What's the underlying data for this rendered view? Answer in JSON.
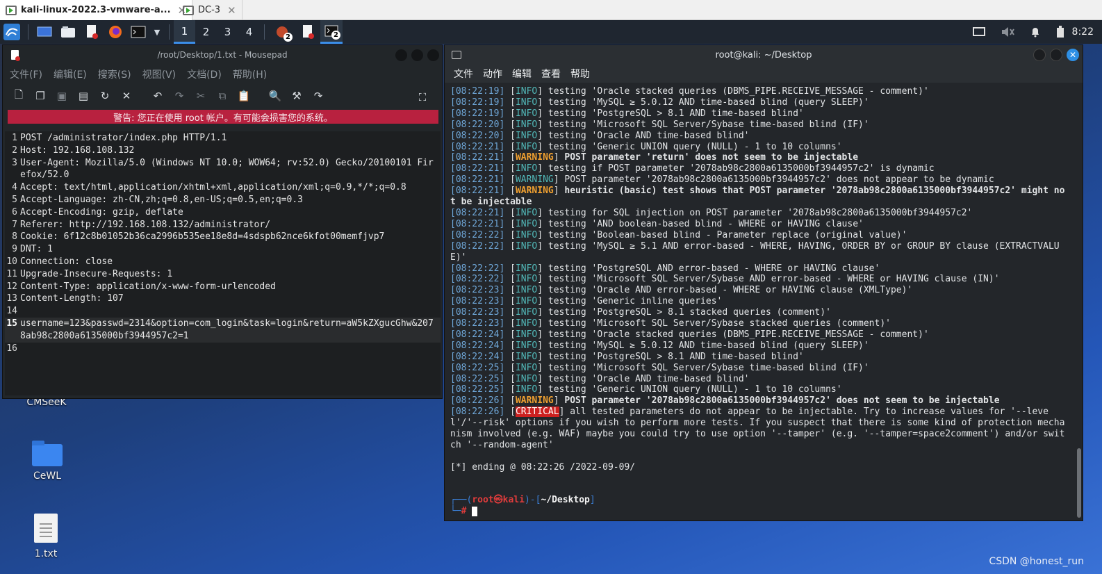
{
  "vm_tabs": {
    "active_label": "kali-linux-2022.3-vmware-a...",
    "inactive_label": "DC-3"
  },
  "panel": {
    "workspaces": [
      "1",
      "2",
      "3",
      "4"
    ],
    "badge_count_1": "2",
    "badge_count_2": "2",
    "clock": "8:22"
  },
  "desktop": {
    "icons": [
      "CMSeeK",
      "CeWL",
      "1.txt"
    ],
    "watermark": "CSDN @honest_run"
  },
  "mousepad": {
    "title": "/root/Desktop/1.txt - Mousepad",
    "menu": [
      "文件(F)",
      "编辑(E)",
      "搜索(S)",
      "视图(V)",
      "文档(D)",
      "帮助(H)"
    ],
    "warning": "警告: 您正在使用 root 帐户。有可能会损害您的系统。",
    "lines": [
      {
        "n": "1",
        "t": "POST /administrator/index.php HTTP/1.1"
      },
      {
        "n": "2",
        "t": "Host: 192.168.108.132"
      },
      {
        "n": "3",
        "t": "User-Agent: Mozilla/5.0 (Windows NT 10.0; WOW64; rv:52.0) Gecko/20100101 Firefox/52.0"
      },
      {
        "n": "4",
        "t": "Accept: text/html,application/xhtml+xml,application/xml;q=0.9,*/*;q=0.8"
      },
      {
        "n": "5",
        "t": "Accept-Language: zh-CN,zh;q=0.8,en-US;q=0.5,en;q=0.3"
      },
      {
        "n": "6",
        "t": "Accept-Encoding: gzip, deflate"
      },
      {
        "n": "7",
        "t": "Referer: http://192.168.108.132/administrator/"
      },
      {
        "n": "8",
        "t": "Cookie: 6f12c8b01052b36ca2996b535ee18e8d=4sdspb62nce6kfot00memfjvp7"
      },
      {
        "n": "9",
        "t": "DNT: 1"
      },
      {
        "n": "10",
        "t": "Connection: close"
      },
      {
        "n": "11",
        "t": "Upgrade-Insecure-Requests: 1"
      },
      {
        "n": "12",
        "t": "Content-Type: application/x-www-form-urlencoded"
      },
      {
        "n": "13",
        "t": "Content-Length: 107"
      },
      {
        "n": "14",
        "t": ""
      },
      {
        "n": "15",
        "t": "username=123&passwd=2314&option=com_login&task=login&return=aW5kZXgucGhw&2078ab98c2800a6135000bf3944957c2=1"
      },
      {
        "n": "16",
        "t": ""
      }
    ]
  },
  "terminal": {
    "title": "root@kali: ~/Desktop",
    "menu": [
      "文件",
      "动作",
      "编辑",
      "查看",
      "帮助"
    ],
    "logs": [
      {
        "ts": "[08:22:19]",
        "lv": "INFO",
        "msg": " testing 'Oracle stacked queries (DBMS_PIPE.RECEIVE_MESSAGE - comment)'"
      },
      {
        "ts": "[08:22:19]",
        "lv": "INFO",
        "msg": " testing 'MySQL ≥ 5.0.12 AND time-based blind (query SLEEP)'"
      },
      {
        "ts": "[08:22:19]",
        "lv": "INFO",
        "msg": " testing 'PostgreSQL > 8.1 AND time-based blind'"
      },
      {
        "ts": "[08:22:20]",
        "lv": "INFO",
        "msg": " testing 'Microsoft SQL Server/Sybase time-based blind (IF)'"
      },
      {
        "ts": "[08:22:20]",
        "lv": "INFO",
        "msg": " testing 'Oracle AND time-based blind'"
      },
      {
        "ts": "[08:22:21]",
        "lv": "INFO",
        "msg": " testing 'Generic UNION query (NULL) - 1 to 10 columns'"
      },
      {
        "ts": "[08:22:21]",
        "lv": "WARNING",
        "msg": " POST parameter 'return' does not seem to be injectable",
        "bold": true
      },
      {
        "ts": "[08:22:21]",
        "lv": "INFO",
        "msg": " testing if POST parameter '2078ab98c2800a6135000bf3944957c2' is dynamic"
      },
      {
        "ts": "[08:22:21]",
        "lv": "WARNING",
        "msg": " POST parameter '2078ab98c2800a6135000bf3944957c2' does not appear to be dynamic",
        "plainlv": true
      },
      {
        "ts": "[08:22:21]",
        "lv": "WARNING",
        "msg": " heuristic (basic) test shows that POST parameter '2078ab98c2800a6135000bf3944957c2' might not be injectable",
        "bold": true
      },
      {
        "ts": "[08:22:21]",
        "lv": "INFO",
        "msg": " testing for SQL injection on POST parameter '2078ab98c2800a6135000bf3944957c2'"
      },
      {
        "ts": "[08:22:21]",
        "lv": "INFO",
        "msg": " testing 'AND boolean-based blind - WHERE or HAVING clause'"
      },
      {
        "ts": "[08:22:22]",
        "lv": "INFO",
        "msg": " testing 'Boolean-based blind - Parameter replace (original value)'"
      },
      {
        "ts": "[08:22:22]",
        "lv": "INFO",
        "msg": " testing 'MySQL ≥ 5.1 AND error-based - WHERE, HAVING, ORDER BY or GROUP BY clause (EXTRACTVALUE)'"
      },
      {
        "ts": "[08:22:22]",
        "lv": "INFO",
        "msg": " testing 'PostgreSQL AND error-based - WHERE or HAVING clause'"
      },
      {
        "ts": "[08:22:22]",
        "lv": "INFO",
        "msg": " testing 'Microsoft SQL Server/Sybase AND error-based - WHERE or HAVING clause (IN)'"
      },
      {
        "ts": "[08:22:23]",
        "lv": "INFO",
        "msg": " testing 'Oracle AND error-based - WHERE or HAVING clause (XMLType)'"
      },
      {
        "ts": "[08:22:23]",
        "lv": "INFO",
        "msg": " testing 'Generic inline queries'"
      },
      {
        "ts": "[08:22:23]",
        "lv": "INFO",
        "msg": " testing 'PostgreSQL > 8.1 stacked queries (comment)'"
      },
      {
        "ts": "[08:22:23]",
        "lv": "INFO",
        "msg": " testing 'Microsoft SQL Server/Sybase stacked queries (comment)'"
      },
      {
        "ts": "[08:22:24]",
        "lv": "INFO",
        "msg": " testing 'Oracle stacked queries (DBMS_PIPE.RECEIVE_MESSAGE - comment)'"
      },
      {
        "ts": "[08:22:24]",
        "lv": "INFO",
        "msg": " testing 'MySQL ≥ 5.0.12 AND time-based blind (query SLEEP)'"
      },
      {
        "ts": "[08:22:24]",
        "lv": "INFO",
        "msg": " testing 'PostgreSQL > 8.1 AND time-based blind'"
      },
      {
        "ts": "[08:22:25]",
        "lv": "INFO",
        "msg": " testing 'Microsoft SQL Server/Sybase time-based blind (IF)'"
      },
      {
        "ts": "[08:22:25]",
        "lv": "INFO",
        "msg": " testing 'Oracle AND time-based blind'"
      },
      {
        "ts": "[08:22:25]",
        "lv": "INFO",
        "msg": " testing 'Generic UNION query (NULL) - 1 to 10 columns'"
      },
      {
        "ts": "[08:22:26]",
        "lv": "WARNING",
        "msg": " POST parameter '2078ab98c2800a6135000bf3944957c2' does not seem to be injectable",
        "bold": true
      },
      {
        "ts": "[08:22:26]",
        "lv": "CRITICAL",
        "msg": " all tested parameters do not appear to be injectable. Try to increase values for '--level'/'--risk' options if you wish to perform more tests. If you suspect that there is some kind of protection mechanism involved (e.g. WAF) maybe you could try to use option '--tamper' (e.g. '--tamper=space2comment') and/or switch '--random-agent'"
      }
    ],
    "ending": "[*] ending @ 08:22:26 /2022-09-09/",
    "prompt": {
      "user": "root",
      "at": "㉿",
      "host": "kali",
      "path": "~/Desktop",
      "symbol": "#"
    }
  }
}
